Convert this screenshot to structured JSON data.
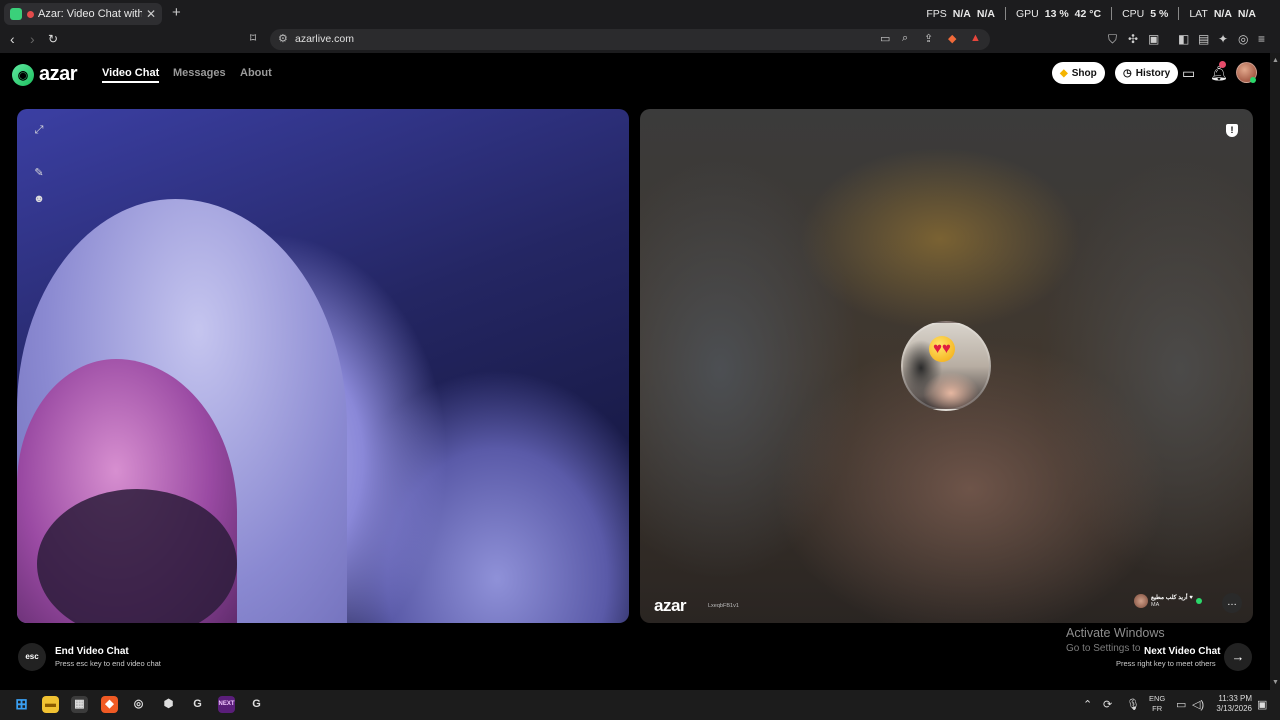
{
  "browser": {
    "tab_title": "Azar: Video Chat with New Pe",
    "new_tab_icon": "+",
    "url": "azarlive.com",
    "perf": {
      "fps_label": "FPS",
      "fps_value": "N/A",
      "fps_value2": "N/A",
      "gpu_label": "GPU",
      "gpu_value": "13 %",
      "gpu_temp": "42 °C",
      "cpu_label": "CPU",
      "cpu_value": "5 %",
      "lat_label": "LAT",
      "lat_value": "N/A",
      "lat_value2": "N/A"
    }
  },
  "header": {
    "logo_text": "azar",
    "nav": [
      "Video Chat",
      "Messages",
      "About"
    ],
    "shop_label": "Shop",
    "history_label": "History"
  },
  "remote": {
    "logo_text": "azar",
    "stream_id": "LxeqbFB1v1",
    "peer_name": "أريد كلب مطيع ♥",
    "peer_country": "MA"
  },
  "controls": {
    "esc_label": "esc",
    "end_title": "End Video Chat",
    "end_sub": "Press esc key to end video chat",
    "next_title": "Next Video Chat",
    "next_sub": "Press right key to meet others"
  },
  "watermark": {
    "line1": "Activate Windows",
    "line2": "Go to Settings to"
  },
  "taskbar": {
    "lang_top": "ENG",
    "lang_bottom": "FR",
    "time": "11:33 PM",
    "date": "3/13/2026"
  },
  "colors": {
    "brand_green": "#1dbf5e",
    "background": "#000000"
  }
}
